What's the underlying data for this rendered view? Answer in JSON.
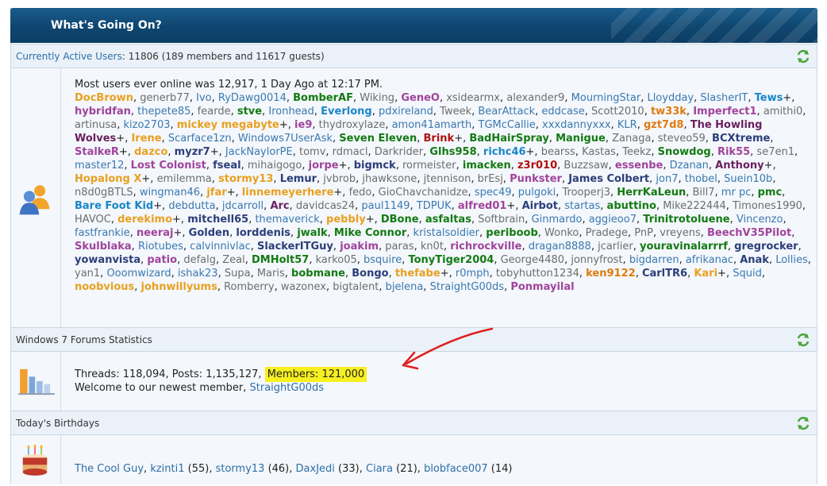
{
  "header": {
    "title": "What's Going On?"
  },
  "active": {
    "label": "Currently Active Users",
    "summary": ": 11806 (189 members and 11617 guests)",
    "record": "Most users ever online was 12,917, 1 Day Ago at 12:17 PM.",
    "users": [
      {
        "n": "DocBrown",
        "c": "gold"
      },
      {
        "n": "generb77",
        "c": "reg"
      },
      {
        "n": "Ivo",
        "c": "blue"
      },
      {
        "n": "RyDawg0014",
        "c": "blue"
      },
      {
        "n": "BomberAF",
        "c": "green"
      },
      {
        "n": "Wiking",
        "c": "reg"
      },
      {
        "n": "GeneO",
        "c": "purple"
      },
      {
        "n": "xsidearmx",
        "c": "reg"
      },
      {
        "n": "alexander9",
        "c": "reg"
      },
      {
        "n": "MourningStar",
        "c": "blue"
      },
      {
        "n": "Lloydday",
        "c": "blue"
      },
      {
        "n": "SlasherIT",
        "c": "blue"
      },
      {
        "n": "Tews",
        "c": "cyan",
        "p": "+"
      },
      {
        "n": "hybridfan",
        "c": "purple"
      },
      {
        "n": "thepete85",
        "c": "blue"
      },
      {
        "n": "fearde",
        "c": "reg"
      },
      {
        "n": "stve",
        "c": "green"
      },
      {
        "n": "Ironhead",
        "c": "blue"
      },
      {
        "n": "Everlong",
        "c": "cyan"
      },
      {
        "n": "pdxireland",
        "c": "blue"
      },
      {
        "n": "Tweek",
        "c": "reg"
      },
      {
        "n": "BearAttack",
        "c": "blue"
      },
      {
        "n": "eddcase",
        "c": "blue"
      },
      {
        "n": "Scott2010",
        "c": "reg"
      },
      {
        "n": "tw33k",
        "c": "orange"
      },
      {
        "n": "Imperfect1",
        "c": "purple"
      },
      {
        "n": "amithi0",
        "c": "reg"
      },
      {
        "n": "artinusa",
        "c": "reg"
      },
      {
        "n": "kizo2703",
        "c": "blue"
      },
      {
        "n": "mickey megabyte",
        "c": "gold",
        "p": "+"
      },
      {
        "n": "ie9",
        "c": "purple"
      },
      {
        "n": "thydroxylaze",
        "c": "reg"
      },
      {
        "n": "amon41amarth",
        "c": "blue"
      },
      {
        "n": "TGMcCallie",
        "c": "blue"
      },
      {
        "n": "xxxdannyxxx",
        "c": "blue"
      },
      {
        "n": "KLR",
        "c": "blue"
      },
      {
        "n": "gzt7d8",
        "c": "orange"
      },
      {
        "n": "The Howling Wolves",
        "c": "maroon",
        "p": "+"
      },
      {
        "n": "Irene",
        "c": "gold"
      },
      {
        "n": "Scarface1zn",
        "c": "blue"
      },
      {
        "n": "Windows7UserAsk",
        "c": "blue"
      },
      {
        "n": "Seven Eleven",
        "c": "green"
      },
      {
        "n": "Brink",
        "c": "red",
        "p": "+"
      },
      {
        "n": "BadHairSpray",
        "c": "green"
      },
      {
        "n": "Manigue",
        "c": "green"
      },
      {
        "n": "Zanaga",
        "c": "reg"
      },
      {
        "n": "steveo59",
        "c": "reg"
      },
      {
        "n": "BCXtreme",
        "c": "navy"
      },
      {
        "n": "StalkeR",
        "c": "purple",
        "p": "+"
      },
      {
        "n": "dazco",
        "c": "gold"
      },
      {
        "n": "myzr7",
        "c": "navy",
        "p": "+"
      },
      {
        "n": "JackNaylorPE",
        "c": "blue"
      },
      {
        "n": "tomv",
        "c": "reg"
      },
      {
        "n": "rdmacl",
        "c": "reg"
      },
      {
        "n": "Darkrider",
        "c": "reg"
      },
      {
        "n": "Glhs958",
        "c": "green"
      },
      {
        "n": "richc46",
        "c": "cyan",
        "p": "+"
      },
      {
        "n": "bearss",
        "c": "reg"
      },
      {
        "n": "Kastas",
        "c": "reg"
      },
      {
        "n": "Teekz",
        "c": "reg"
      },
      {
        "n": "Snowdog",
        "c": "green"
      },
      {
        "n": "Rik55",
        "c": "purple"
      },
      {
        "n": "se7en1",
        "c": "reg"
      },
      {
        "n": "master12",
        "c": "blue"
      },
      {
        "n": "Lost Colonist",
        "c": "purple"
      },
      {
        "n": "fseal",
        "c": "navy"
      },
      {
        "n": "mihaigogo",
        "c": "reg"
      },
      {
        "n": "jorpe",
        "c": "purple",
        "p": "+"
      },
      {
        "n": "bigmck",
        "c": "navy"
      },
      {
        "n": "rormeister",
        "c": "reg"
      },
      {
        "n": "imacken",
        "c": "green"
      },
      {
        "n": "z3r010",
        "c": "red"
      },
      {
        "n": "Buzzsaw",
        "c": "reg"
      },
      {
        "n": "essenbe",
        "c": "purple"
      },
      {
        "n": "Dzanan",
        "c": "blue"
      },
      {
        "n": "Anthony",
        "c": "maroon",
        "p": "+"
      },
      {
        "n": "Hopalong X",
        "c": "gold",
        "p": "+"
      },
      {
        "n": "emilemma",
        "c": "reg"
      },
      {
        "n": "stormy13",
        "c": "gold"
      },
      {
        "n": "Lemur",
        "c": "navy"
      },
      {
        "n": "jvbrob",
        "c": "reg"
      },
      {
        "n": "jhawksone",
        "c": "reg"
      },
      {
        "n": "jtennison",
        "c": "reg"
      },
      {
        "n": "brEsj",
        "c": "reg"
      },
      {
        "n": "Punkster",
        "c": "purple"
      },
      {
        "n": "James Colbert",
        "c": "navy"
      },
      {
        "n": "jon7",
        "c": "blue"
      },
      {
        "n": "thobel",
        "c": "blue"
      },
      {
        "n": "Suein10b",
        "c": "blue"
      },
      {
        "n": "n8d0gBTLS",
        "c": "reg"
      },
      {
        "n": "wingman46",
        "c": "blue"
      },
      {
        "n": "jfar",
        "c": "gold",
        "p": "+"
      },
      {
        "n": "linnemeyerhere",
        "c": "gold",
        "p": "+"
      },
      {
        "n": "fedo",
        "c": "reg"
      },
      {
        "n": "GioChavchanidze",
        "c": "reg"
      },
      {
        "n": "spec49",
        "c": "blue"
      },
      {
        "n": "pulgoki",
        "c": "blue"
      },
      {
        "n": "Trooperj3",
        "c": "reg"
      },
      {
        "n": "HerrKaLeun",
        "c": "green"
      },
      {
        "n": "Bill7",
        "c": "reg"
      },
      {
        "n": "mr pc",
        "c": "blue"
      },
      {
        "n": "pmc",
        "c": "green"
      },
      {
        "n": "Bare Foot Kid",
        "c": "cyan",
        "p": "+"
      },
      {
        "n": "debdutta",
        "c": "blue"
      },
      {
        "n": "jdcarroll",
        "c": "blue"
      },
      {
        "n": "Arc",
        "c": "maroon"
      },
      {
        "n": "davidcas24",
        "c": "reg"
      },
      {
        "n": "paul1149",
        "c": "blue"
      },
      {
        "n": "TDPUK",
        "c": "blue"
      },
      {
        "n": "alfred01",
        "c": "purple",
        "p": "+"
      },
      {
        "n": "Airbot",
        "c": "navy"
      },
      {
        "n": "startas",
        "c": "blue"
      },
      {
        "n": "abuttino",
        "c": "green"
      },
      {
        "n": "Mike222444",
        "c": "reg"
      },
      {
        "n": "Timones1990",
        "c": "reg"
      },
      {
        "n": "HAVOC",
        "c": "reg"
      },
      {
        "n": "derekimo",
        "c": "gold",
        "p": "+"
      },
      {
        "n": "mitchell65",
        "c": "navy"
      },
      {
        "n": "themaverick",
        "c": "blue"
      },
      {
        "n": "pebbly",
        "c": "gold",
        "p": "+"
      },
      {
        "n": "DBone",
        "c": "green"
      },
      {
        "n": "asfaltas",
        "c": "green"
      },
      {
        "n": "Softbrain",
        "c": "reg"
      },
      {
        "n": "Ginmardo",
        "c": "blue"
      },
      {
        "n": "aggieoo7",
        "c": "blue"
      },
      {
        "n": "Trinitrotoluene",
        "c": "green"
      },
      {
        "n": "Vincenzo",
        "c": "blue"
      },
      {
        "n": "fastfrankie",
        "c": "blue"
      },
      {
        "n": "neeraj",
        "c": "purple",
        "p": "+"
      },
      {
        "n": "Golden",
        "c": "navy"
      },
      {
        "n": "lorddenis",
        "c": "navy"
      },
      {
        "n": "jwalk",
        "c": "green"
      },
      {
        "n": "Mike Connor",
        "c": "green"
      },
      {
        "n": "kristalsoldier",
        "c": "blue"
      },
      {
        "n": "periboob",
        "c": "green"
      },
      {
        "n": "Wonko",
        "c": "reg"
      },
      {
        "n": "Pradege",
        "c": "reg"
      },
      {
        "n": "PnP",
        "c": "reg"
      },
      {
        "n": "vreyens",
        "c": "reg"
      },
      {
        "n": "BeechV35Pilot",
        "c": "purple"
      },
      {
        "n": "Skulblaka",
        "c": "purple"
      },
      {
        "n": "Riotubes",
        "c": "blue"
      },
      {
        "n": "calvinnivlac",
        "c": "blue"
      },
      {
        "n": "SlackerITGuy",
        "c": "navy"
      },
      {
        "n": "joakim",
        "c": "purple"
      },
      {
        "n": "paras",
        "c": "reg"
      },
      {
        "n": "kn0t",
        "c": "reg"
      },
      {
        "n": "richrockville",
        "c": "purple"
      },
      {
        "n": "dragan8888",
        "c": "blue"
      },
      {
        "n": "jcarlier",
        "c": "reg"
      },
      {
        "n": "youravinalarrrf",
        "c": "green"
      },
      {
        "n": "gregrocker",
        "c": "navy"
      },
      {
        "n": "yowanvista",
        "c": "navy"
      },
      {
        "n": "patio",
        "c": "purple"
      },
      {
        "n": "defalg",
        "c": "reg"
      },
      {
        "n": "Zeal",
        "c": "reg"
      },
      {
        "n": "DMHolt57",
        "c": "green"
      },
      {
        "n": "karko05",
        "c": "reg"
      },
      {
        "n": "bsquire",
        "c": "blue"
      },
      {
        "n": "TonyTiger2004",
        "c": "green"
      },
      {
        "n": "George4480",
        "c": "reg"
      },
      {
        "n": "jonnyfrost",
        "c": "reg"
      },
      {
        "n": "bigdarren",
        "c": "blue"
      },
      {
        "n": "afrikanac",
        "c": "blue"
      },
      {
        "n": "Anak",
        "c": "navy"
      },
      {
        "n": "Lollies",
        "c": "blue"
      },
      {
        "n": "yan1",
        "c": "reg"
      },
      {
        "n": "Ooomwizard",
        "c": "blue"
      },
      {
        "n": "ishak23",
        "c": "blue"
      },
      {
        "n": "Supa",
        "c": "reg"
      },
      {
        "n": "Maris",
        "c": "reg"
      },
      {
        "n": "bobmane",
        "c": "green"
      },
      {
        "n": "Bongo",
        "c": "navy"
      },
      {
        "n": "thefabe",
        "c": "gold",
        "p": "+"
      },
      {
        "n": "r0mph",
        "c": "blue"
      },
      {
        "n": "tobyhutton1234",
        "c": "reg"
      },
      {
        "n": "ken9122",
        "c": "orange"
      },
      {
        "n": "CarlTR6",
        "c": "navy"
      },
      {
        "n": "Kari",
        "c": "gold",
        "p": "+"
      },
      {
        "n": "Squid",
        "c": "blue"
      },
      {
        "n": "noobvious",
        "c": "gold"
      },
      {
        "n": "johnwillyums",
        "c": "gold"
      },
      {
        "n": "Romberry",
        "c": "reg"
      },
      {
        "n": "wazonex",
        "c": "reg"
      },
      {
        "n": "bigtalent",
        "c": "reg"
      },
      {
        "n": "bjelena",
        "c": "blue"
      },
      {
        "n": "StraightG00ds",
        "c": "blue"
      },
      {
        "n": "Ponmayilal",
        "c": "purple"
      }
    ]
  },
  "stats": {
    "label": "Windows 7 Forums Statistics",
    "line_pre": "Threads: 118,094, Posts: 1,135,127, ",
    "members": "Members: 121,000",
    "welcome": "Welcome to our newest member, ",
    "newest": "StraightG00ds"
  },
  "birthdays": {
    "label": "Today's Birthdays",
    "people": [
      {
        "n": "The Cool Guy",
        "age": ""
      },
      {
        "n": "kzinti1",
        "age": "(55)"
      },
      {
        "n": "stormy13",
        "age": "(46)"
      },
      {
        "n": "DaxJedi",
        "age": "(33)"
      },
      {
        "n": "Ciara",
        "age": "(21)"
      },
      {
        "n": "blobface007",
        "age": "(14)"
      }
    ]
  },
  "colors": {
    "header": "#0f4670",
    "highlight": "#f7f01f",
    "arrow": "#e02020"
  }
}
